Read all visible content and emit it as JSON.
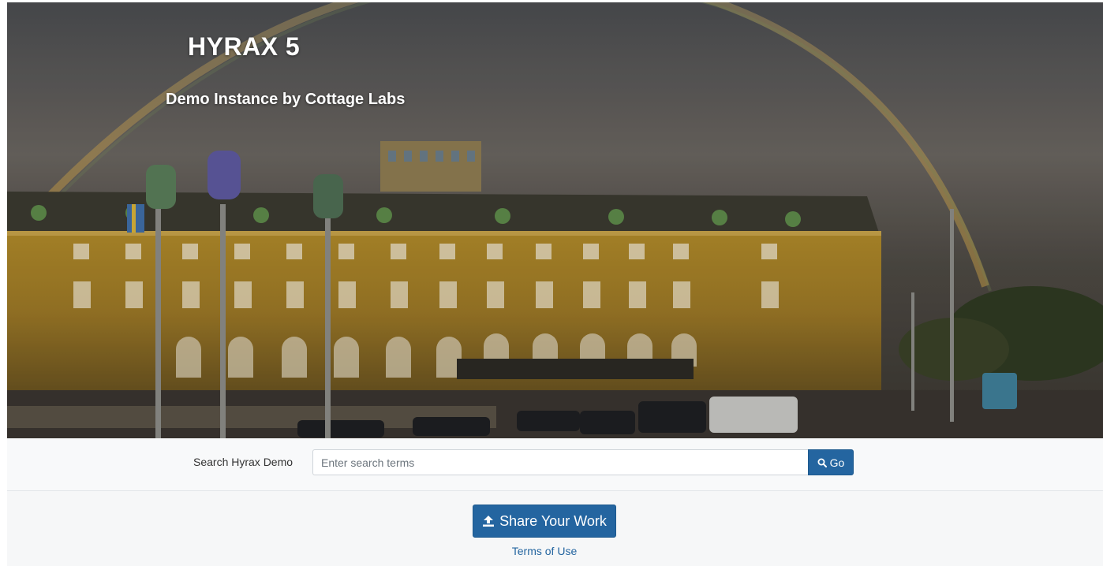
{
  "hero": {
    "title": "HYRAX 5",
    "subtitle": "Demo Instance by Cottage Labs"
  },
  "search": {
    "label": "Search Hyrax Demo",
    "placeholder": "Enter search terms",
    "value": "",
    "button_label": "Go",
    "button_icon": "search-icon"
  },
  "share": {
    "button_label": "Share Your Work",
    "button_icon": "upload-icon"
  },
  "footer": {
    "terms_link": "Terms of Use"
  },
  "colors": {
    "primary": "#2465a0",
    "strip_background": "#f8f9fa"
  }
}
